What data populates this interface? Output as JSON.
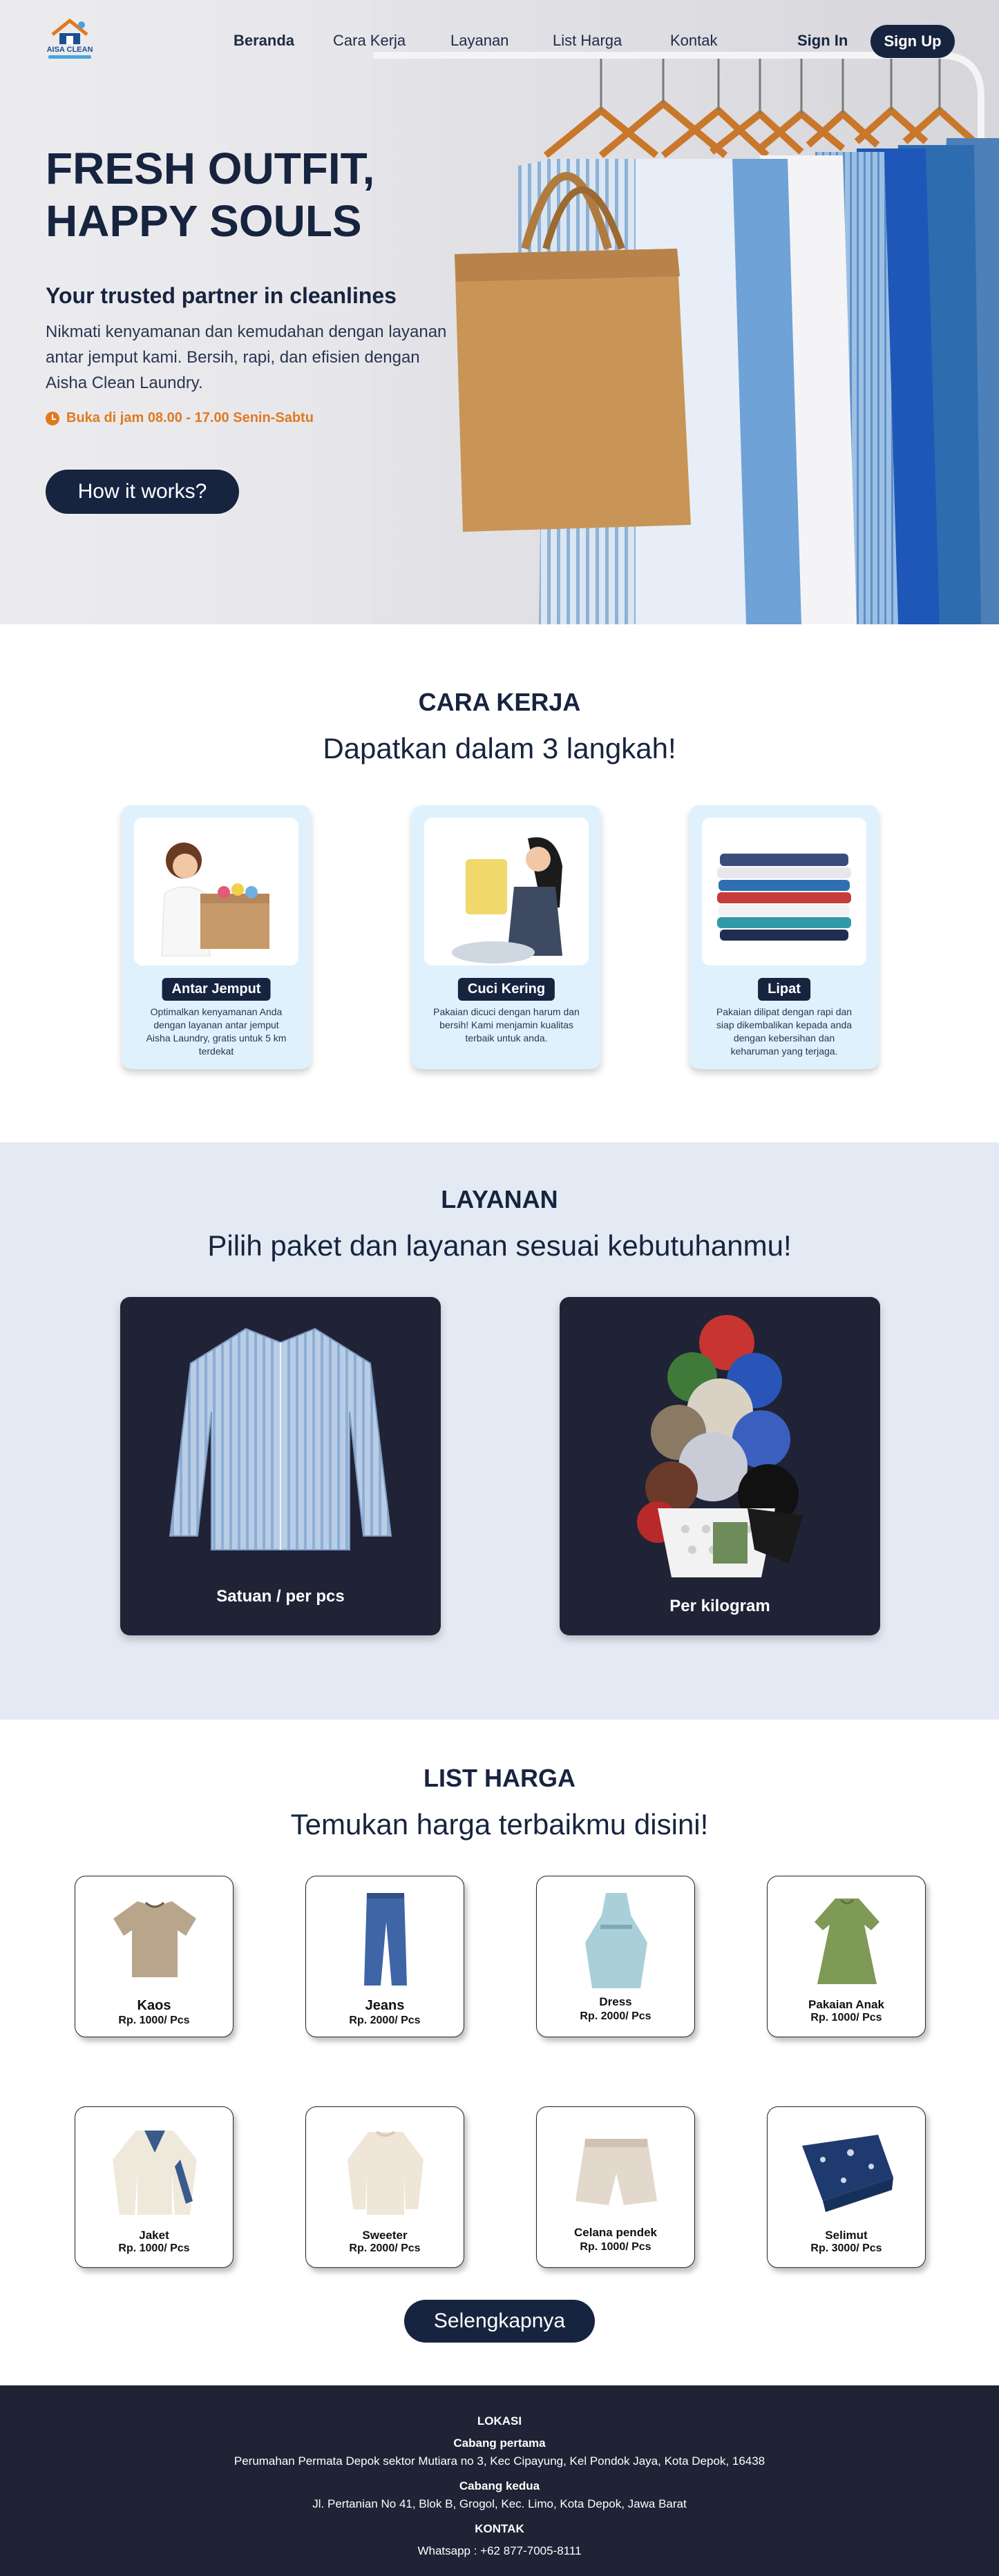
{
  "brand": {
    "logo_text": "AISA CLEAN"
  },
  "nav": {
    "items": [
      "Beranda",
      "Cara Kerja",
      "Layanan",
      "List Harga",
      "Kontak"
    ],
    "active": "Beranda",
    "sign_in": "Sign In",
    "sign_up": "Sign Up"
  },
  "hero": {
    "title_line1": "FRESH OUTFIT,",
    "title_line2": "HAPPY SOULS",
    "subtitle": "Your trusted partner in cleanlines",
    "description": "Nikmati kenyamanan dan kemudahan dengan layanan antar jemput kami.  Bersih, rapi, dan efisien dengan Aisha Clean Laundry.",
    "hours": "Buka di jam 08.00 - 17.00 Senin-Sabtu",
    "cta": "How it works?"
  },
  "cara_kerja": {
    "title": "CARA KERJA",
    "subtitle": "Dapatkan dalam 3 langkah!",
    "steps": [
      {
        "label": "Antar Jemput",
        "desc": "Optimalkan kenyamanan Anda dengan layanan antar jemput Aisha Laundry, gratis untuk 5 km terdekat"
      },
      {
        "label": "Cuci Kering",
        "desc": "Pakaian dicuci dengan harum dan bersih! Kami menjamin kualitas terbaik untuk anda."
      },
      {
        "label": "Lipat",
        "desc": "Pakaian dilipat dengan rapi dan siap dikembalikan kepada anda dengan kebersihan dan keharuman yang terjaga."
      }
    ]
  },
  "layanan": {
    "title": "LAYANAN",
    "subtitle": "Pilih paket dan layanan sesuai kebutuhanmu!",
    "services": [
      {
        "label": "Satuan / per pcs"
      },
      {
        "label": "Per kilogram"
      }
    ]
  },
  "list_harga": {
    "title": "LIST HARGA",
    "subtitle": "Temukan harga terbaikmu disini!",
    "items": [
      {
        "name": "Kaos",
        "price": "Rp. 1000/ Pcs"
      },
      {
        "name": "Jeans",
        "price": "Rp. 2000/ Pcs"
      },
      {
        "name": "Dress",
        "price": "Rp. 2000/ Pcs"
      },
      {
        "name": "Pakaian Anak",
        "price": "Rp. 1000/ Pcs"
      },
      {
        "name": "Jaket",
        "price": "Rp. 1000/ Pcs"
      },
      {
        "name": "Sweeter",
        "price": "Rp. 2000/ Pcs"
      },
      {
        "name": "Celana pendek",
        "price": "Rp. 1000/ Pcs"
      },
      {
        "name": "Selimut",
        "price": "Rp. 3000/ Pcs"
      }
    ],
    "more": "Selengkapnya"
  },
  "footer": {
    "lokasi_title": "LOKASI",
    "branch1_title": "Cabang pertama",
    "branch1_address": "Perumahan Permata Depok sektor Mutiara no 3, Kec Cipayung, Kel Pondok Jaya, Kota Depok, 16438",
    "branch2_title": "Cabang kedua",
    "branch2_address": "Jl. Pertanian No 41, Blok B, Grogol, Kec. Limo, Kota Depok, Jawa Barat",
    "kontak_title": "KONTAK",
    "whatsapp": "Whatsapp : +62 877-7005-8111"
  },
  "colors": {
    "navy": "#17243f",
    "accent_orange": "#e07a1f",
    "card_blue": "#dff1fc",
    "dark_card": "#1f2335",
    "section_bg": "#e3eaf3"
  },
  "icons": [
    "logo-house-icon",
    "clock-icon"
  ]
}
